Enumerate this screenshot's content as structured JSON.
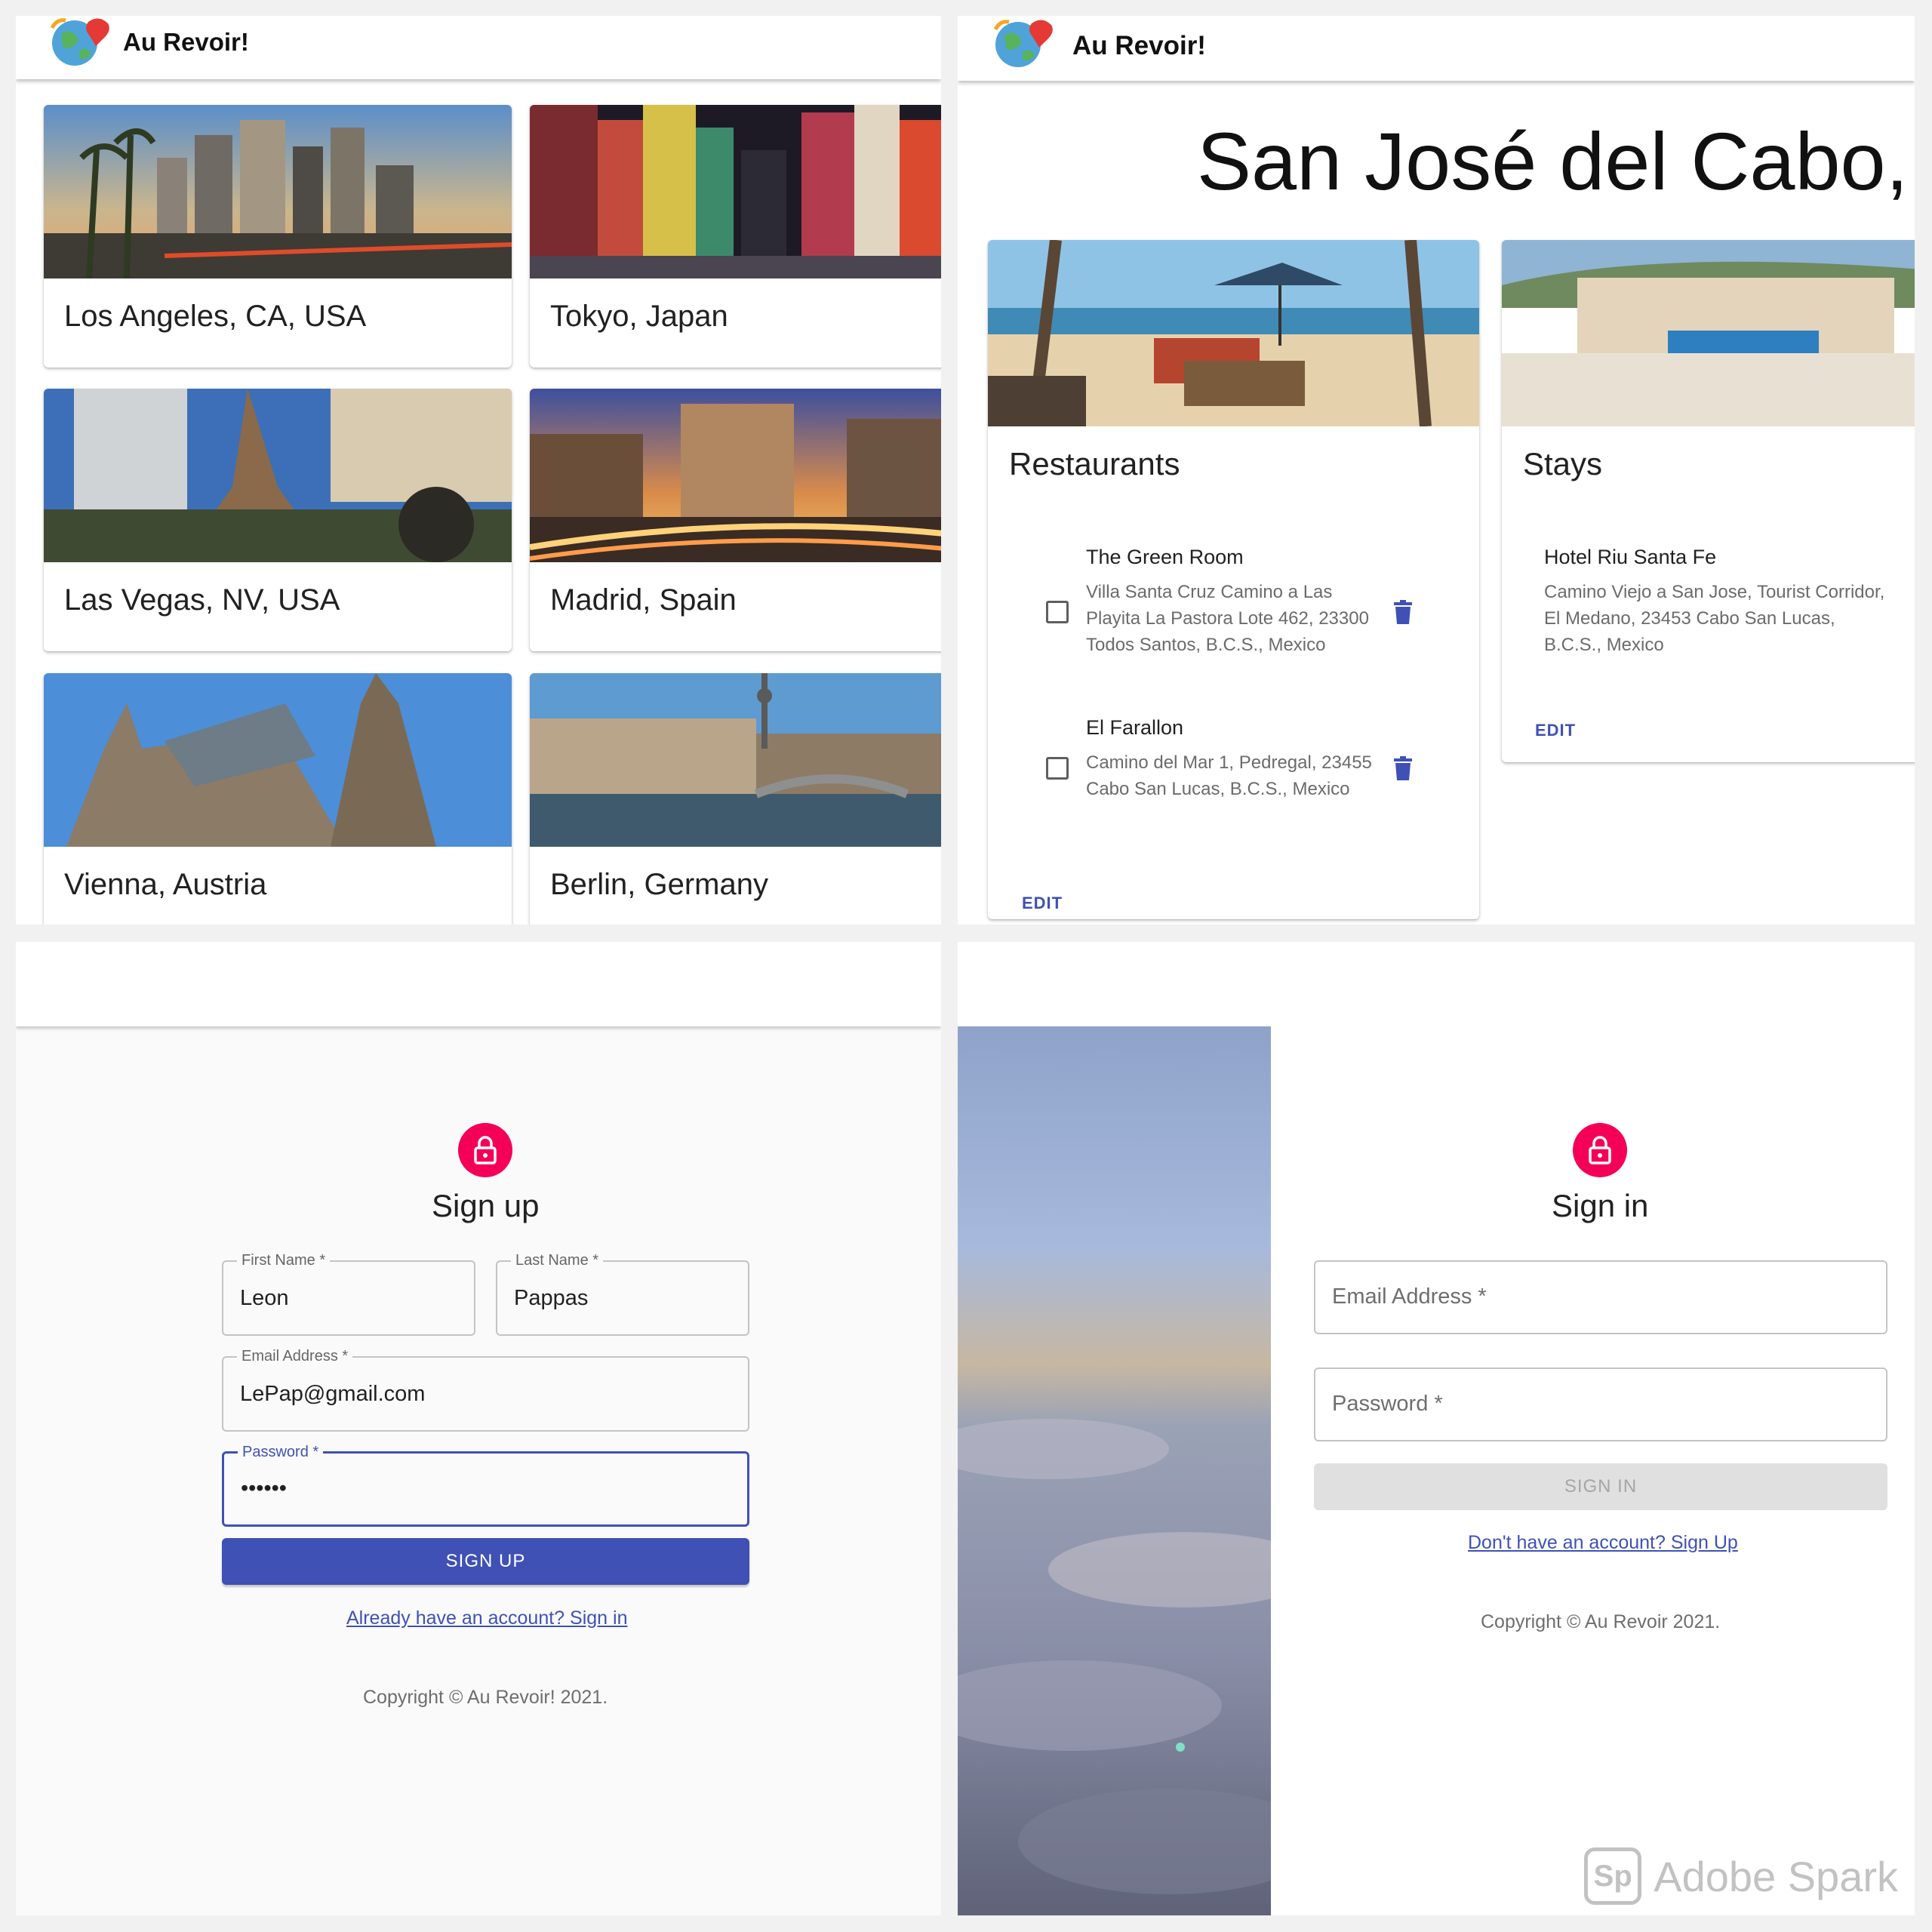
{
  "brand": "Au Revoir!",
  "colors": {
    "primary": "#3f51b5",
    "avatar": "#f50057",
    "link": "#3f51b5"
  },
  "cities": [
    {
      "name": "Los Angeles, CA, USA"
    },
    {
      "name": "Tokyo, Japan"
    },
    {
      "name": "Las Vegas, NV, USA"
    },
    {
      "name": "Madrid, Spain"
    },
    {
      "name": "Vienna, Austria"
    },
    {
      "name": "Berlin, Germany"
    }
  ],
  "destination": {
    "title": "San José del Cabo, B",
    "restaurants": {
      "heading": "Restaurants",
      "items": [
        {
          "name": "The Green Room",
          "address": "Villa Santa Cruz Camino a Las Playita La Pastora Lote 462, 23300 Todos Santos, B.C.S., Mexico"
        },
        {
          "name": "El Farallon",
          "address": "Camino del Mar 1, Pedregal, 23455 Cabo San Lucas, B.C.S., Mexico"
        }
      ],
      "edit_label": "EDIT"
    },
    "stays": {
      "heading": "Stays",
      "items": [
        {
          "name": "Hotel Riu Santa Fe",
          "address": "Camino Viejo a San Jose, Tourist Corridor, El Medano, 23453 Cabo San Lucas, B.C.S., Mexico"
        }
      ],
      "edit_label": "EDIT"
    }
  },
  "signup": {
    "title": "Sign up",
    "first_name": {
      "label": "First Name *",
      "value": "Leon"
    },
    "last_name": {
      "label": "Last Name *",
      "value": "Pappas"
    },
    "email": {
      "label": "Email Address *",
      "value": "LePap@gmail.com"
    },
    "password": {
      "label": "Password *",
      "value": "••••••"
    },
    "button": "SIGN UP",
    "link": "Already have an account? Sign in",
    "copyright": "Copyright © Au Revoir! 2021."
  },
  "signin": {
    "title": "Sign in",
    "email_placeholder": "Email Address *",
    "password_placeholder": "Password *",
    "button": "SIGN IN",
    "link": "Don't have an account? Sign Up",
    "copyright": "Copyright © Au Revoir 2021."
  },
  "watermark": {
    "badge": "Sp",
    "text": "Adobe Spark"
  },
  "icons": [
    "lock-icon",
    "trash-icon",
    "checkbox-icon",
    "globe-logo-icon"
  ]
}
